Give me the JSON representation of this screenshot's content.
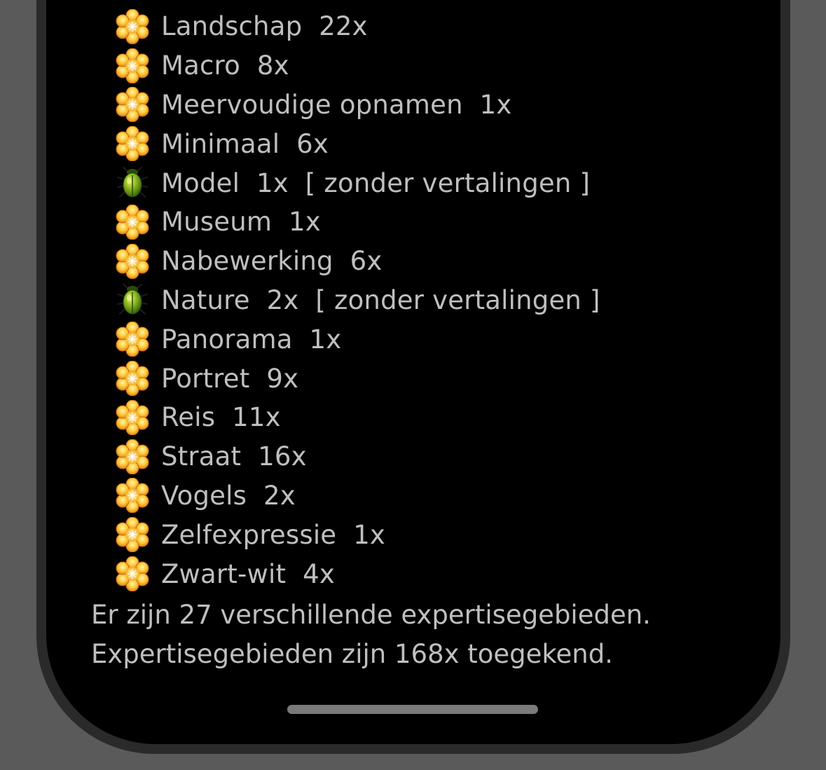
{
  "expertise_list": {
    "items": [
      {
        "icon": "flower-icon",
        "label": "Landschap  22x",
        "status": ""
      },
      {
        "icon": "flower-icon",
        "label": "Macro  8x",
        "status": ""
      },
      {
        "icon": "flower-icon",
        "label": "Meervoudige opnamen  1x",
        "status": ""
      },
      {
        "icon": "flower-icon",
        "label": "Minimaal  6x",
        "status": ""
      },
      {
        "icon": "beetle-icon",
        "label": "Model  1x",
        "status": "[ zonder vertalingen ]"
      },
      {
        "icon": "flower-icon",
        "label": "Museum  1x",
        "status": ""
      },
      {
        "icon": "flower-icon",
        "label": "Nabewerking  6x",
        "status": ""
      },
      {
        "icon": "beetle-icon",
        "label": "Nature  2x",
        "status": "[ zonder vertalingen ]"
      },
      {
        "icon": "flower-icon",
        "label": "Panorama  1x",
        "status": ""
      },
      {
        "icon": "flower-icon",
        "label": "Portret  9x",
        "status": ""
      },
      {
        "icon": "flower-icon",
        "label": "Reis  11x",
        "status": ""
      },
      {
        "icon": "flower-icon",
        "label": "Straat  16x",
        "status": ""
      },
      {
        "icon": "flower-icon",
        "label": "Vogels  2x",
        "status": ""
      },
      {
        "icon": "flower-icon",
        "label": "Zelfexpressie  1x",
        "status": ""
      },
      {
        "icon": "flower-icon",
        "label": "Zwart-wit  4x",
        "status": ""
      }
    ]
  },
  "summary": {
    "line1": "Er zijn 27 verschillende expertisegebieden.",
    "line2": "Expertisegebieden zijn 168x toegekend."
  },
  "colors": {
    "background": "#000000",
    "text": "#bfbfbf",
    "device_frame": "#2a2a2a",
    "outer": "#5a5a5a",
    "home_indicator": "#7a7a7a"
  }
}
